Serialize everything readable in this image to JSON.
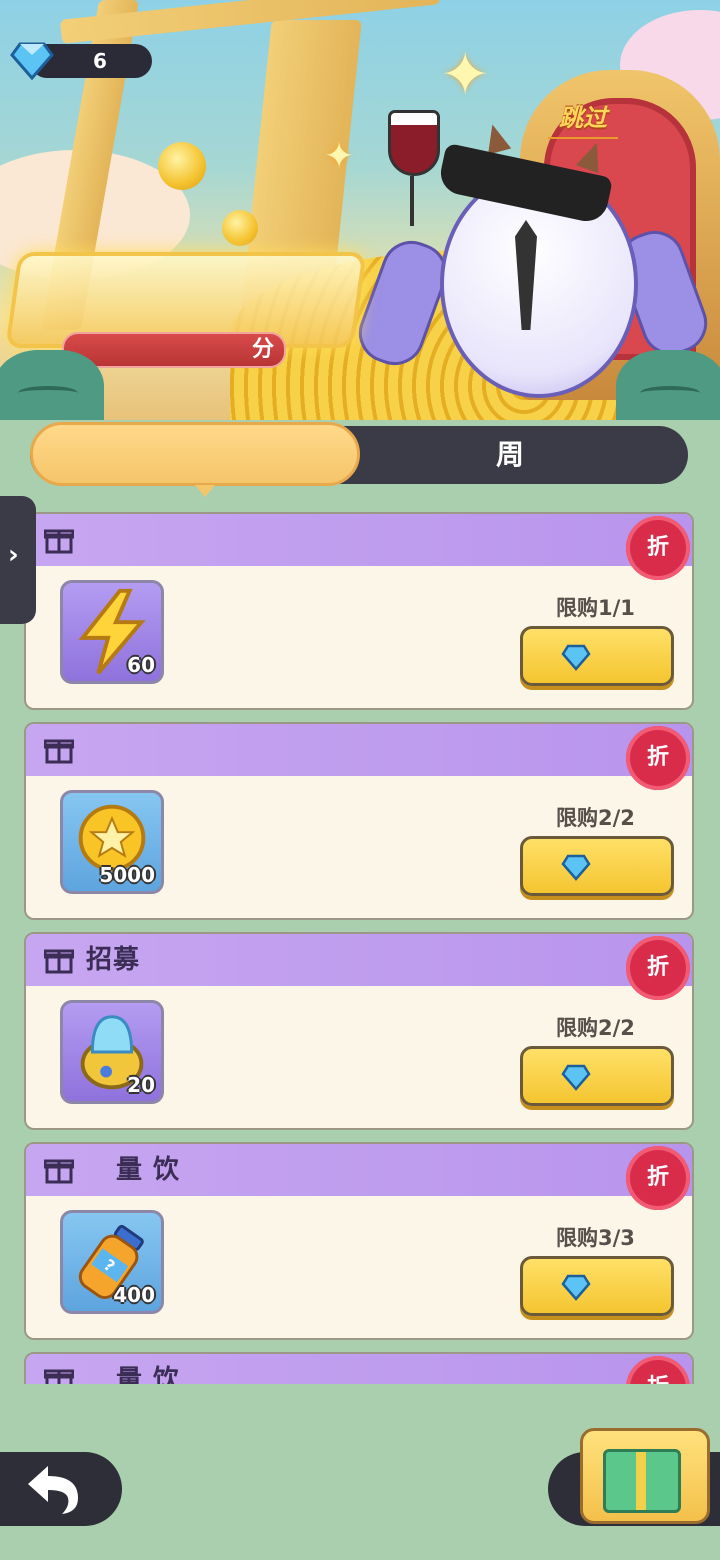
{
  "header": {
    "gems": "6",
    "skip_label": "跳过",
    "score_suffix": "分"
  },
  "tabs": {
    "left_label": "",
    "right_label": "周"
  },
  "offers": [
    {
      "title": "",
      "badge": "折",
      "item_icon": "lightning-icon",
      "qty": "60",
      "limit": "限购1/1"
    },
    {
      "title": "",
      "badge": "折",
      "item_icon": "gold-coin-icon",
      "qty": "5000",
      "limit": "限购2/2"
    },
    {
      "title": "招募",
      "badge": "折",
      "item_icon": "recruit-orb-icon",
      "qty": "20",
      "limit": "限购2/2"
    },
    {
      "title": "量 饮",
      "badge": "折",
      "item_icon": "energy-drink-icon",
      "qty": "400",
      "limit": "限购3/3"
    },
    {
      "title": "量 饮",
      "badge": "折",
      "item_icon": "energy-drink-icon",
      "qty": "",
      "limit": ""
    }
  ],
  "colors": {
    "accent": "#f5c56a",
    "badge": "#d92c4b",
    "card_header": "#c7a6f1"
  }
}
